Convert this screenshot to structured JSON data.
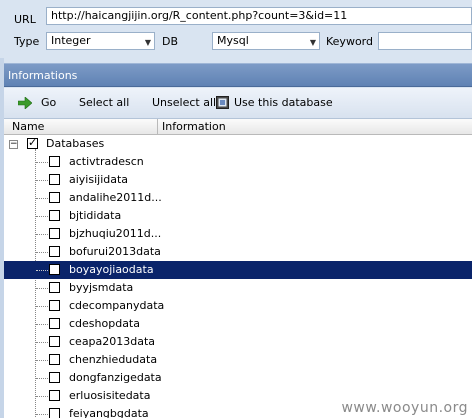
{
  "form": {
    "url_label": "URL",
    "url_value": "http://haicangjijin.org/R_content.php?count=3&id=11",
    "type_label": "Type",
    "type_value": "Integer",
    "db_label": "DB",
    "db_value": "Mysql",
    "keyword_label": "Keyword",
    "keyword_value": ""
  },
  "panel": {
    "title": "Informations"
  },
  "toolbar": {
    "go": "Go",
    "select_all": "Select all",
    "unselect_all": "Unselect all",
    "use_db": "Use this database"
  },
  "grid": {
    "col_name": "Name",
    "col_info": "Information"
  },
  "tree": {
    "root": "Databases",
    "items": [
      "activtradescn",
      "aiyisijidata",
      "andalihe2011d...",
      "bjtididata",
      "bjzhuqiu2011d...",
      "bofurui2013data",
      "boyayojiaodata",
      "byyjsmdata",
      "cdecompanydata",
      "cdeshopdata",
      "ceapa2013data",
      "chenzhiedudata",
      "dongfanzigedata",
      "erluosisitedata",
      "feiyangbgdata"
    ],
    "selected_index": 6
  },
  "watermark": "www.wooyun.org"
}
